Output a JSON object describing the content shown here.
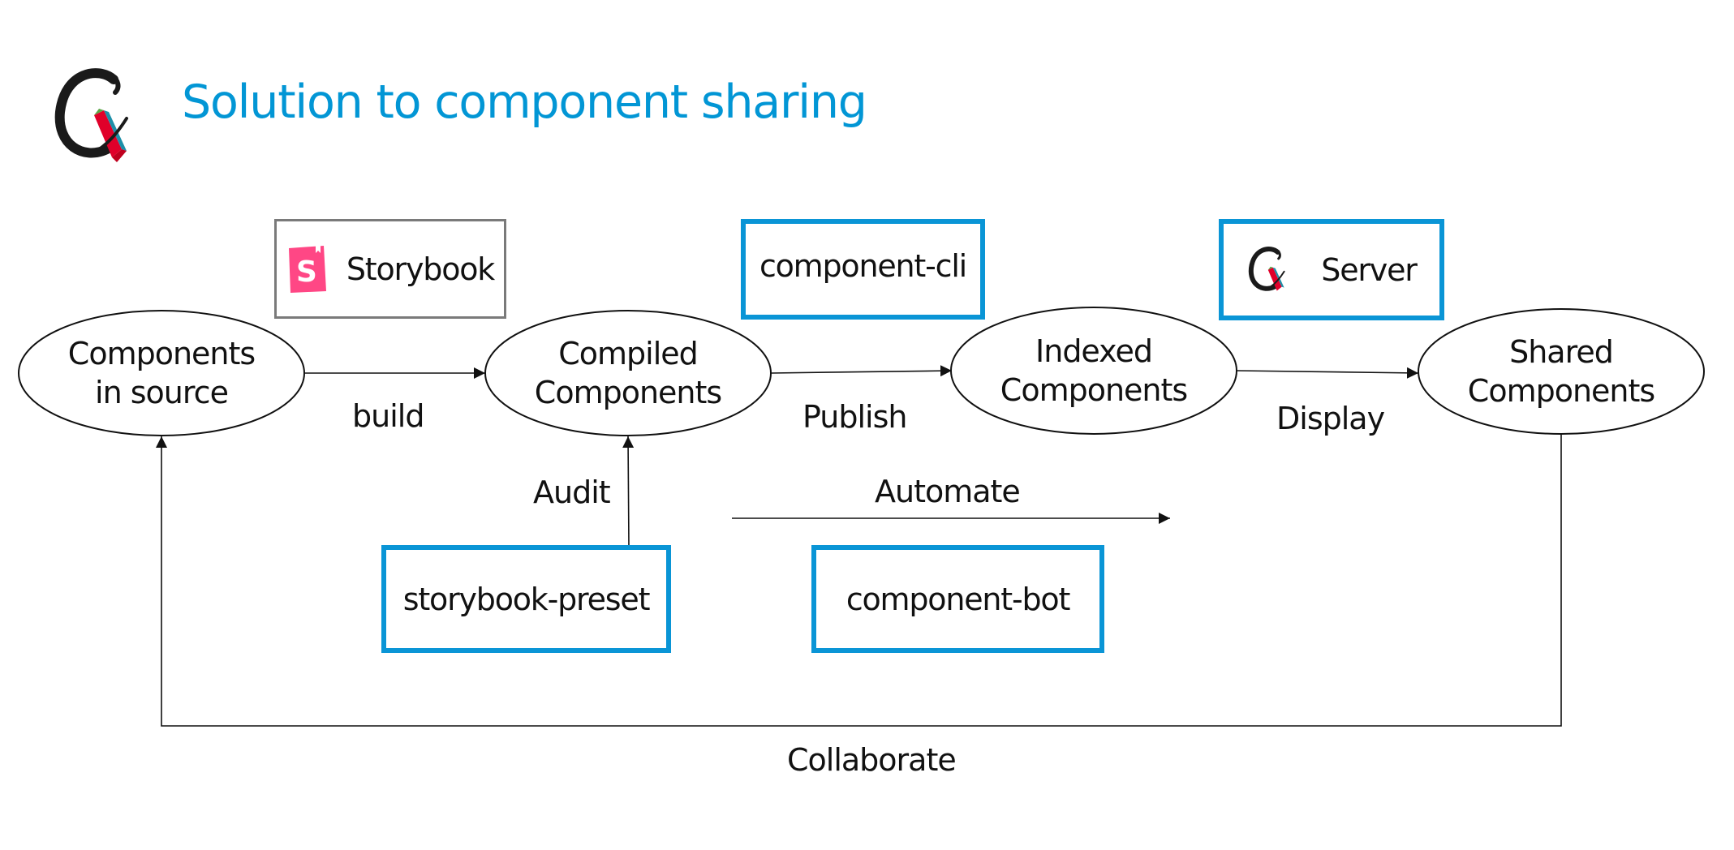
{
  "header": {
    "title": "Solution to component sharing",
    "title_color": "#0296d5",
    "logo": "cx-brand-logo"
  },
  "nodes": [
    {
      "id": "source",
      "lines": [
        "Components",
        "in source"
      ]
    },
    {
      "id": "compiled",
      "lines": [
        "Compiled",
        "Components"
      ]
    },
    {
      "id": "indexed",
      "lines": [
        "Indexed",
        "Components"
      ]
    },
    {
      "id": "shared",
      "lines": [
        "Shared",
        "Components"
      ]
    }
  ],
  "edges": [
    {
      "from": "source",
      "to": "compiled",
      "label": "build"
    },
    {
      "from": "compiled",
      "to": "indexed",
      "label": "Publish"
    },
    {
      "from": "indexed",
      "to": "shared",
      "label": "Display"
    },
    {
      "from": "storybook-preset",
      "to": "compiled",
      "label": "Audit"
    },
    {
      "from": "",
      "to": "",
      "label": "Automate"
    },
    {
      "from": "shared",
      "to": "source",
      "label": "Collaborate"
    }
  ],
  "tools": {
    "storybook": {
      "label": "Storybook",
      "icon": "storybook-logo-icon",
      "icon_color": "#ff4785"
    },
    "component_cli": {
      "label": "component-cli"
    },
    "server": {
      "label": "Server",
      "icon": "cx-brand-logo"
    },
    "storybook_preset": {
      "label": "storybook-preset"
    },
    "component_bot": {
      "label": "component-bot"
    }
  },
  "colors": {
    "accent_border": "#0a95d6",
    "neutral_border": "#7a7a7a",
    "logo_red": "#e0002a",
    "logo_green": "#5aa646",
    "logo_teal": "#1d8fa8"
  }
}
